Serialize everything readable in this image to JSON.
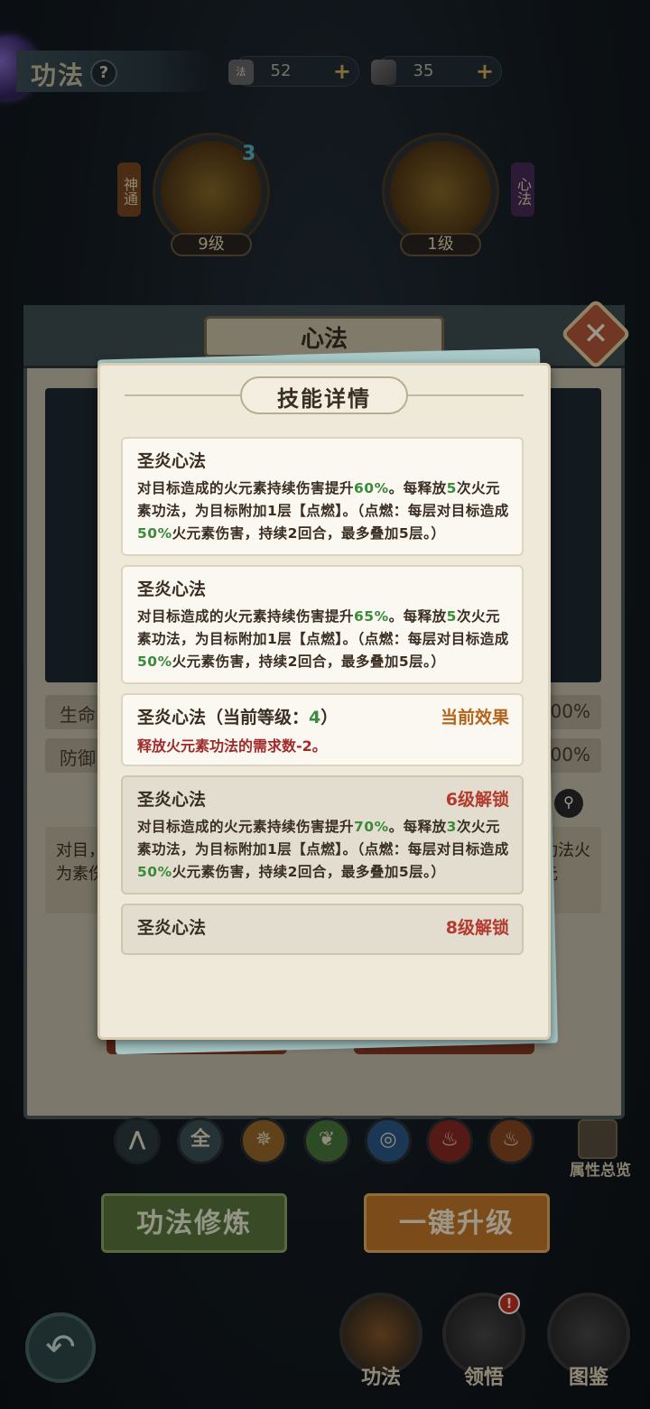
{
  "header": {
    "title": "功法",
    "help": "?",
    "resources": [
      {
        "name": "scroll-resource",
        "icon": "scroll-icon",
        "tag": "法",
        "value": "52",
        "plus": "+"
      },
      {
        "name": "shard-resource",
        "icon": "shard-icon",
        "value": "35",
        "plus": "+"
      }
    ]
  },
  "skills": {
    "left": {
      "tag": "神通",
      "level": "9级",
      "count": "3"
    },
    "right": {
      "tag": "心法",
      "level": "1级"
    }
  },
  "panel": {
    "title": "心法",
    "close": "✕",
    "stats": [
      {
        "label": "生命",
        "value": "00%"
      },
      {
        "label": "防御",
        "value": "00%"
      }
    ],
    "desc_left": "对目，为素伤",
    "desc_right": "功法火元"
  },
  "elements": [
    {
      "name": "filter-all-arrow",
      "glyph": "⋀",
      "color": "#2d3a40"
    },
    {
      "name": "filter-all",
      "glyph": "全",
      "color": "#3d5258"
    },
    {
      "name": "filter-metal",
      "glyph": "✵",
      "color": "#9a6a2a"
    },
    {
      "name": "filter-wood",
      "glyph": "❦",
      "color": "#4a7a3a"
    },
    {
      "name": "filter-water",
      "glyph": "◎",
      "color": "#2a5a8a"
    },
    {
      "name": "filter-fire",
      "glyph": "♨",
      "color": "#8a2a22"
    },
    {
      "name": "filter-earth",
      "glyph": "♨",
      "color": "#8a4a22"
    }
  ],
  "attr_label": "属性总览",
  "buttons": {
    "train": "功法修炼",
    "upgrade": "一键升级"
  },
  "nav": [
    {
      "name": "nav-gongfa",
      "label": "功法",
      "color": "#8a5a2a"
    },
    {
      "name": "nav-lingwu",
      "label": "领悟",
      "color": "#4a4a4a"
    },
    {
      "name": "nav-tujian",
      "label": "图鉴",
      "color": "#4a4a4a"
    }
  ],
  "badge": "!",
  "back": "↶",
  "modal": {
    "title": "技能详情",
    "cards": [
      {
        "name": "圣炎心法",
        "state": "normal",
        "desc_parts": [
          "对目标造成的火元素持续伤害提升",
          "60%",
          "。每释放",
          "5",
          "次火元素功法，为目标附加1层【点燃】。（点燃：每层对目标造成",
          "50%",
          "火元素伤害，持续2回合，最多叠加5层。）"
        ]
      },
      {
        "name": "圣炎心法",
        "state": "normal",
        "desc_parts": [
          "对目标造成的火元素持续伤害提升",
          "65%",
          "。每释放",
          "5",
          "次火元素功法，为目标附加1层【点燃】。（点燃：每层对目标造成",
          "50%",
          "火元素伤害，持续2回合，最多叠加5层。）"
        ]
      },
      {
        "name": "圣炎心法（当前等级：",
        "name_level": "4",
        "name_end": "）",
        "state": "current",
        "tag": "当前效果",
        "effect": "释放火元素功法的需求数-2。"
      },
      {
        "name": "圣炎心法",
        "state": "locked",
        "tag": "6级解锁",
        "desc_parts": [
          "对目标造成的火元素持续伤害提升",
          "70%",
          "。每释放",
          "3",
          "次火元素功法，为目标附加1层【点燃】。（点燃：每层对目标造成",
          "50%",
          "火元素伤害，持续2回合，最多叠加5层。）"
        ]
      },
      {
        "name": "圣炎心法",
        "state": "locked",
        "tag": "8级解锁"
      }
    ]
  }
}
